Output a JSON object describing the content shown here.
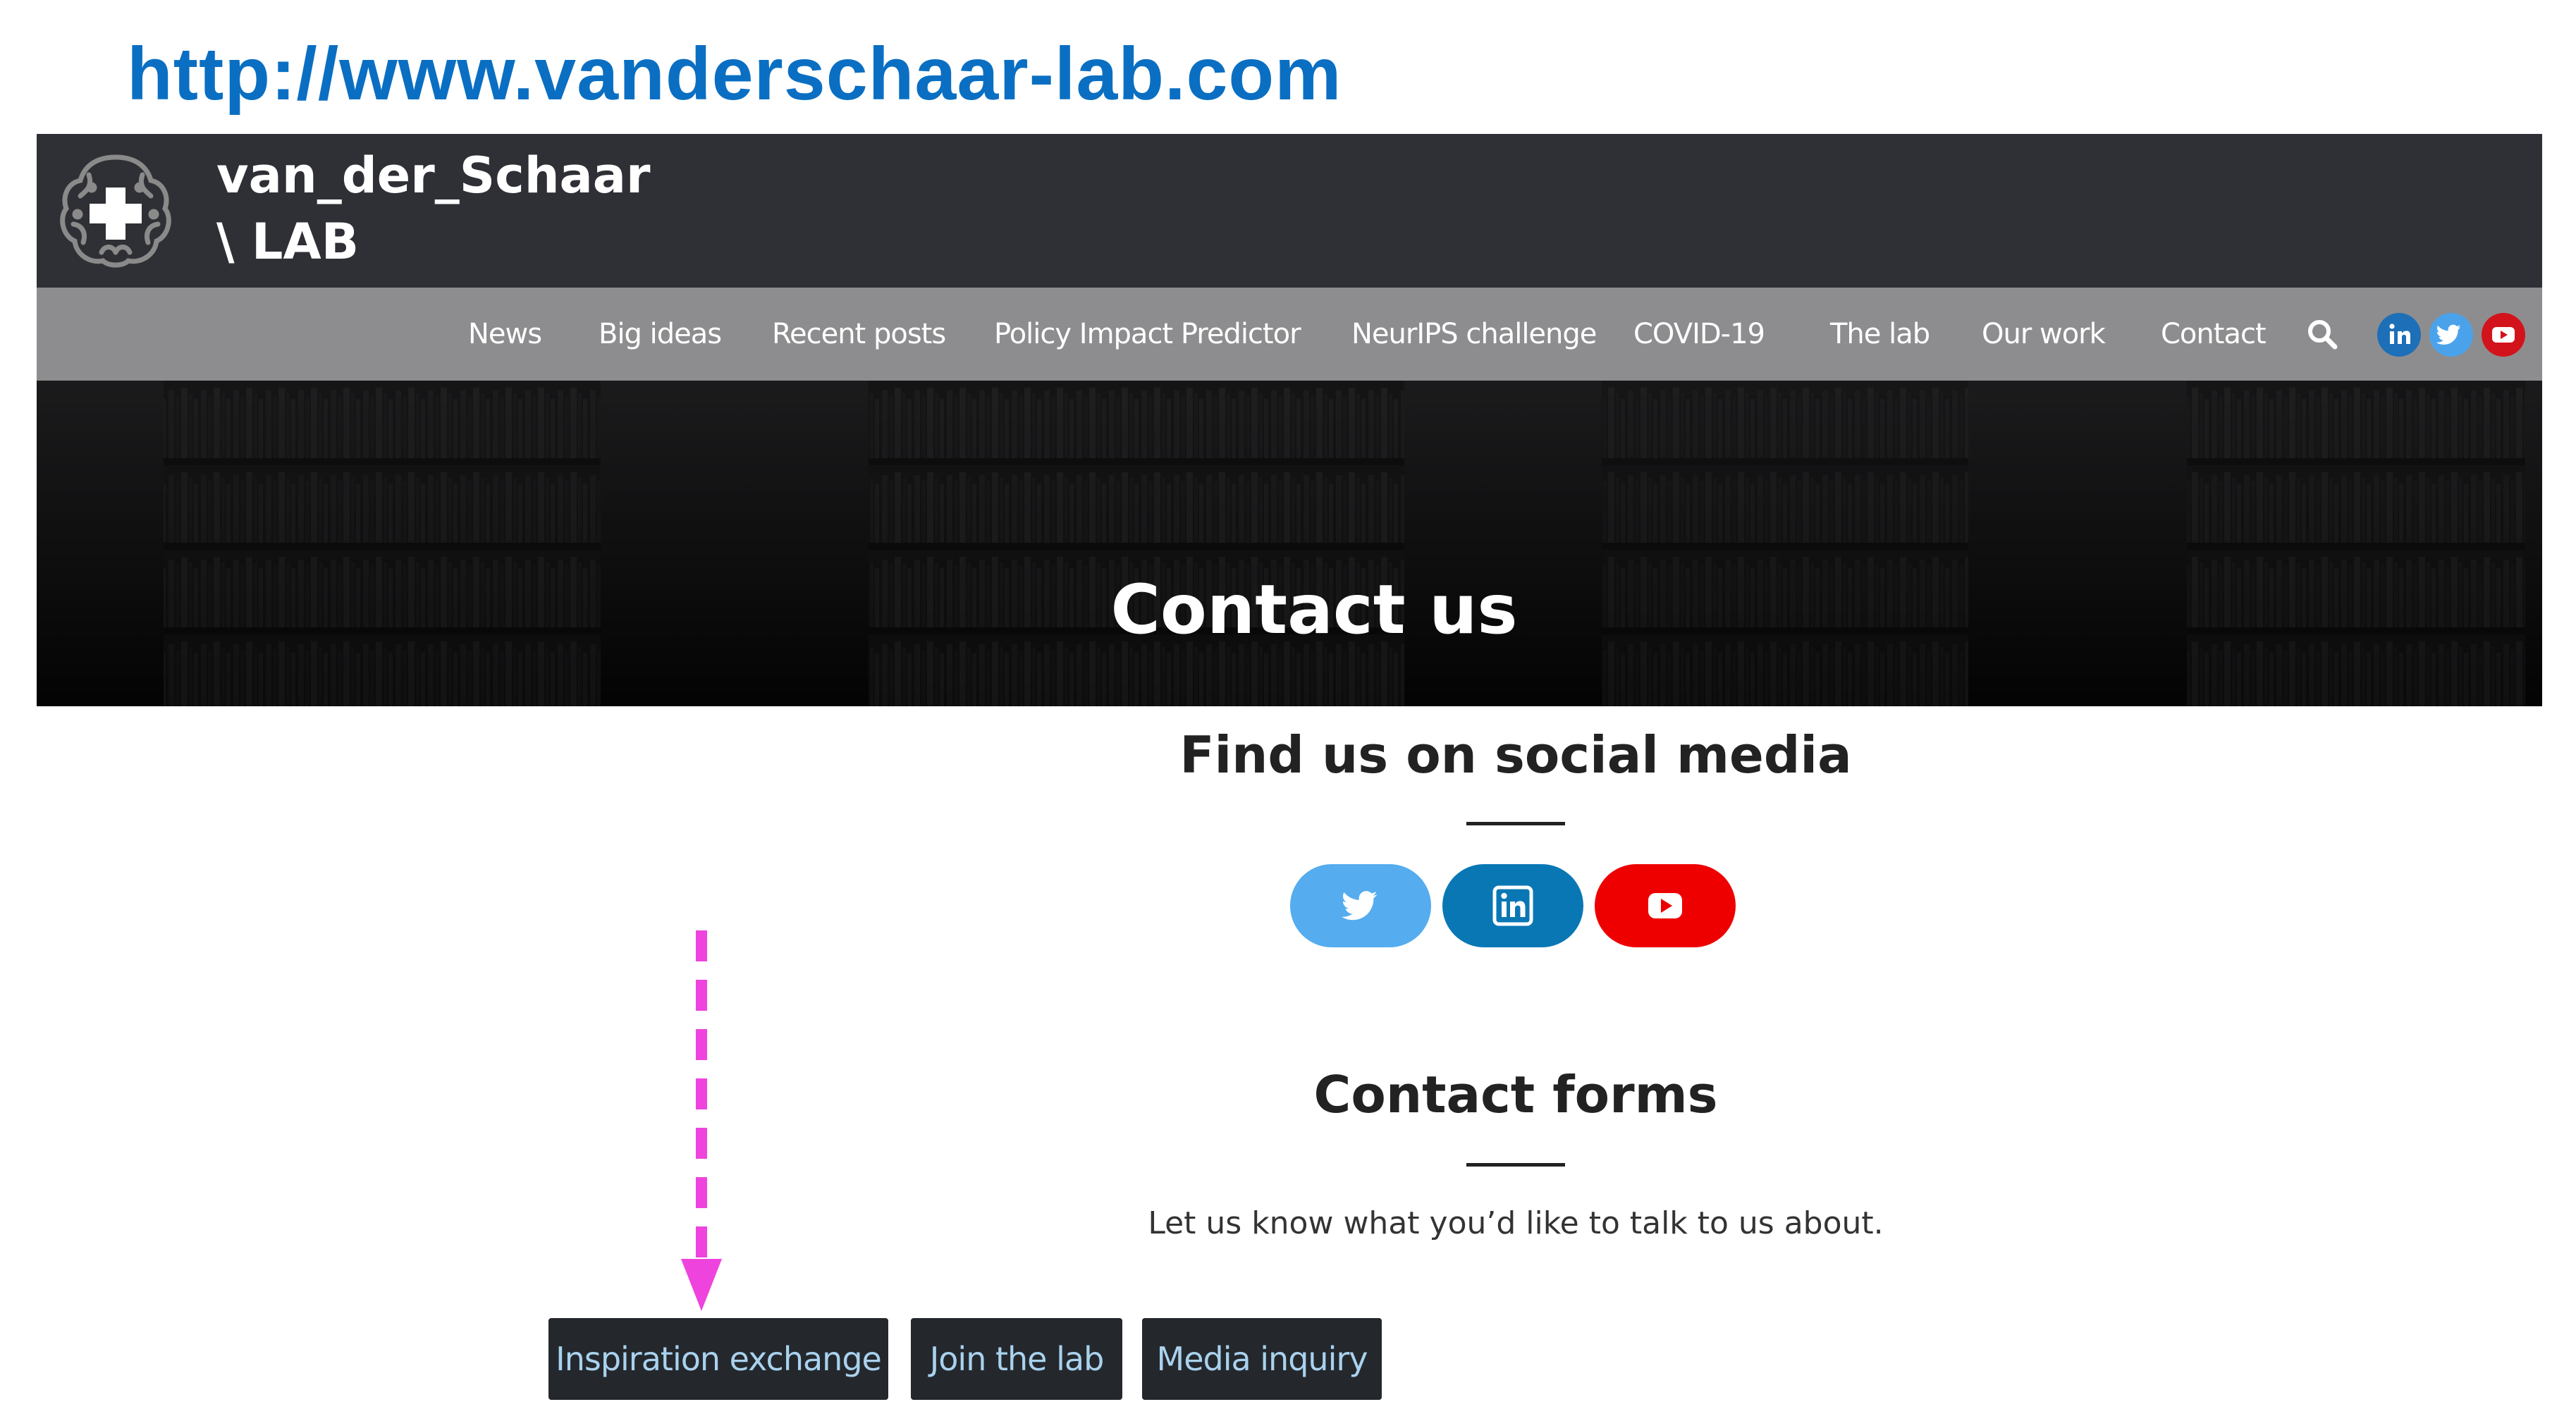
{
  "url_caption": "http://www.vanderschaar-lab.com",
  "header": {
    "title_line1": "van_der_Schaar",
    "title_line2": "\\ LAB",
    "logo_icon": "brain-plus-icon"
  },
  "nav": {
    "items": [
      {
        "label": "News"
      },
      {
        "label": "Big ideas"
      },
      {
        "label": "Recent posts"
      },
      {
        "label": "Policy Impact Predictor"
      },
      {
        "label": "NeurIPS challenge"
      },
      {
        "label": "COVID-19"
      },
      {
        "label": "The lab"
      },
      {
        "label": "Our work"
      },
      {
        "label": "Contact"
      }
    ],
    "search_icon": "search-icon",
    "social": [
      {
        "icon": "linkedin-icon",
        "color": "#1d6fb8"
      },
      {
        "icon": "twitter-icon",
        "color": "#4aa3ea"
      },
      {
        "icon": "youtube-icon",
        "color": "#d3131b"
      }
    ]
  },
  "hero": {
    "title": "Contact us"
  },
  "social_section": {
    "heading": "Find us on social media",
    "buttons": [
      {
        "icon": "twitter-icon",
        "color": "#55acee"
      },
      {
        "icon": "linkedin-icon",
        "color": "#0a77b5"
      },
      {
        "icon": "youtube-icon",
        "color": "#ee0000"
      }
    ]
  },
  "contact_section": {
    "heading": "Contact forms",
    "lead": "Let us know what you’d like to talk to us about.",
    "buttons": [
      {
        "label": "Inspiration exchange"
      },
      {
        "label": "Join the lab"
      },
      {
        "label": "Media inquiry"
      }
    ]
  },
  "annotation": {
    "arrow_color": "#ee44dd"
  }
}
